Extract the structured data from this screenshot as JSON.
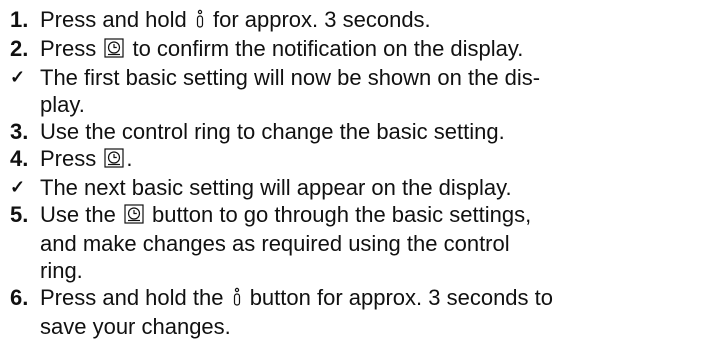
{
  "steps": [
    {
      "marker": "1.",
      "before": "Press and hold ",
      "icon": "info-button-icon",
      "after": " for approx. 3 seconds."
    },
    {
      "marker": "2.",
      "before": "Press ",
      "icon": "clock-button-icon",
      "after": " to confirm the notification on the display."
    },
    {
      "marker": "✓",
      "before": "The first basic setting will now be shown on the dis-",
      "line2": "play."
    },
    {
      "marker": "3.",
      "before": "Use the control ring to change the basic setting."
    },
    {
      "marker": "4.",
      "before": "Press ",
      "icon": "clock-button-icon",
      "after": "."
    },
    {
      "marker": "✓",
      "before": "The next basic setting will appear on the display."
    },
    {
      "marker": "5.",
      "before": "Use the ",
      "icon": "clock-button-icon",
      "after": " button to go through the basic settings,",
      "line2": "and make changes as required using the control",
      "line3": "ring."
    },
    {
      "marker": "6.",
      "before": "Press and hold the ",
      "icon": "info-button-icon",
      "after": " button for approx. 3 seconds to",
      "line2": "save your changes."
    }
  ]
}
